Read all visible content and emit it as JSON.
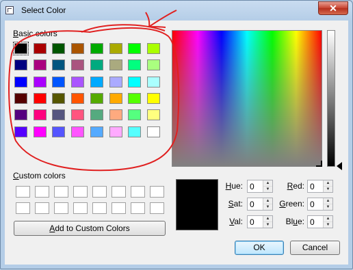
{
  "window": {
    "title": "Select Color",
    "close_glyph": "✕"
  },
  "basic": {
    "label": "Basic colors",
    "underline_char": "B",
    "rows": [
      [
        "#000000",
        "#aa0000",
        "#005500",
        "#aa5500",
        "#00aa00",
        "#aaaa00",
        "#00ff00",
        "#aaff00"
      ],
      [
        "#000080",
        "#aa007f",
        "#00557f",
        "#aa557f",
        "#00aa7f",
        "#aaaa7f",
        "#00ff7f",
        "#aaff7f"
      ],
      [
        "#0000ff",
        "#aa00ff",
        "#0055ff",
        "#aa55ff",
        "#00aaff",
        "#aaaaff",
        "#00ffff",
        "#aaffff"
      ],
      [
        "#550000",
        "#ff0000",
        "#555500",
        "#ff5500",
        "#55aa00",
        "#ffaa00",
        "#55ff00",
        "#ffff00"
      ],
      [
        "#55007f",
        "#ff007f",
        "#55557f",
        "#ff557f",
        "#55aa7f",
        "#ffaa7f",
        "#55ff7f",
        "#ffff7f"
      ],
      [
        "#5500ff",
        "#ff00ff",
        "#5555ff",
        "#ff55ff",
        "#55aaff",
        "#ffaaff",
        "#55ffff",
        "#ffffff"
      ]
    ]
  },
  "custom": {
    "label": "Custom colors",
    "underline_char": "C",
    "rows": 2,
    "cols": 8
  },
  "buttons": {
    "add_prefix": "",
    "add_u": "A",
    "add_rest": "dd to Custom Colors",
    "ok": "OK",
    "cancel": "Cancel"
  },
  "fields": {
    "hue": {
      "u": "H",
      "rest": "ue:",
      "value": "0"
    },
    "sat": {
      "u": "S",
      "rest": "at:",
      "value": "0"
    },
    "val": {
      "u": "V",
      "rest": "al:",
      "value": "0"
    },
    "red": {
      "u": "R",
      "rest": "ed:",
      "value": "0"
    },
    "green": {
      "pre": "",
      "u": "G",
      "rest": "reen:",
      "value": "0"
    },
    "blue": {
      "pre": "Bl",
      "u": "u",
      "rest": "e:",
      "value": "0"
    }
  },
  "current_color": "#000000",
  "annotation_color": "#e02020"
}
